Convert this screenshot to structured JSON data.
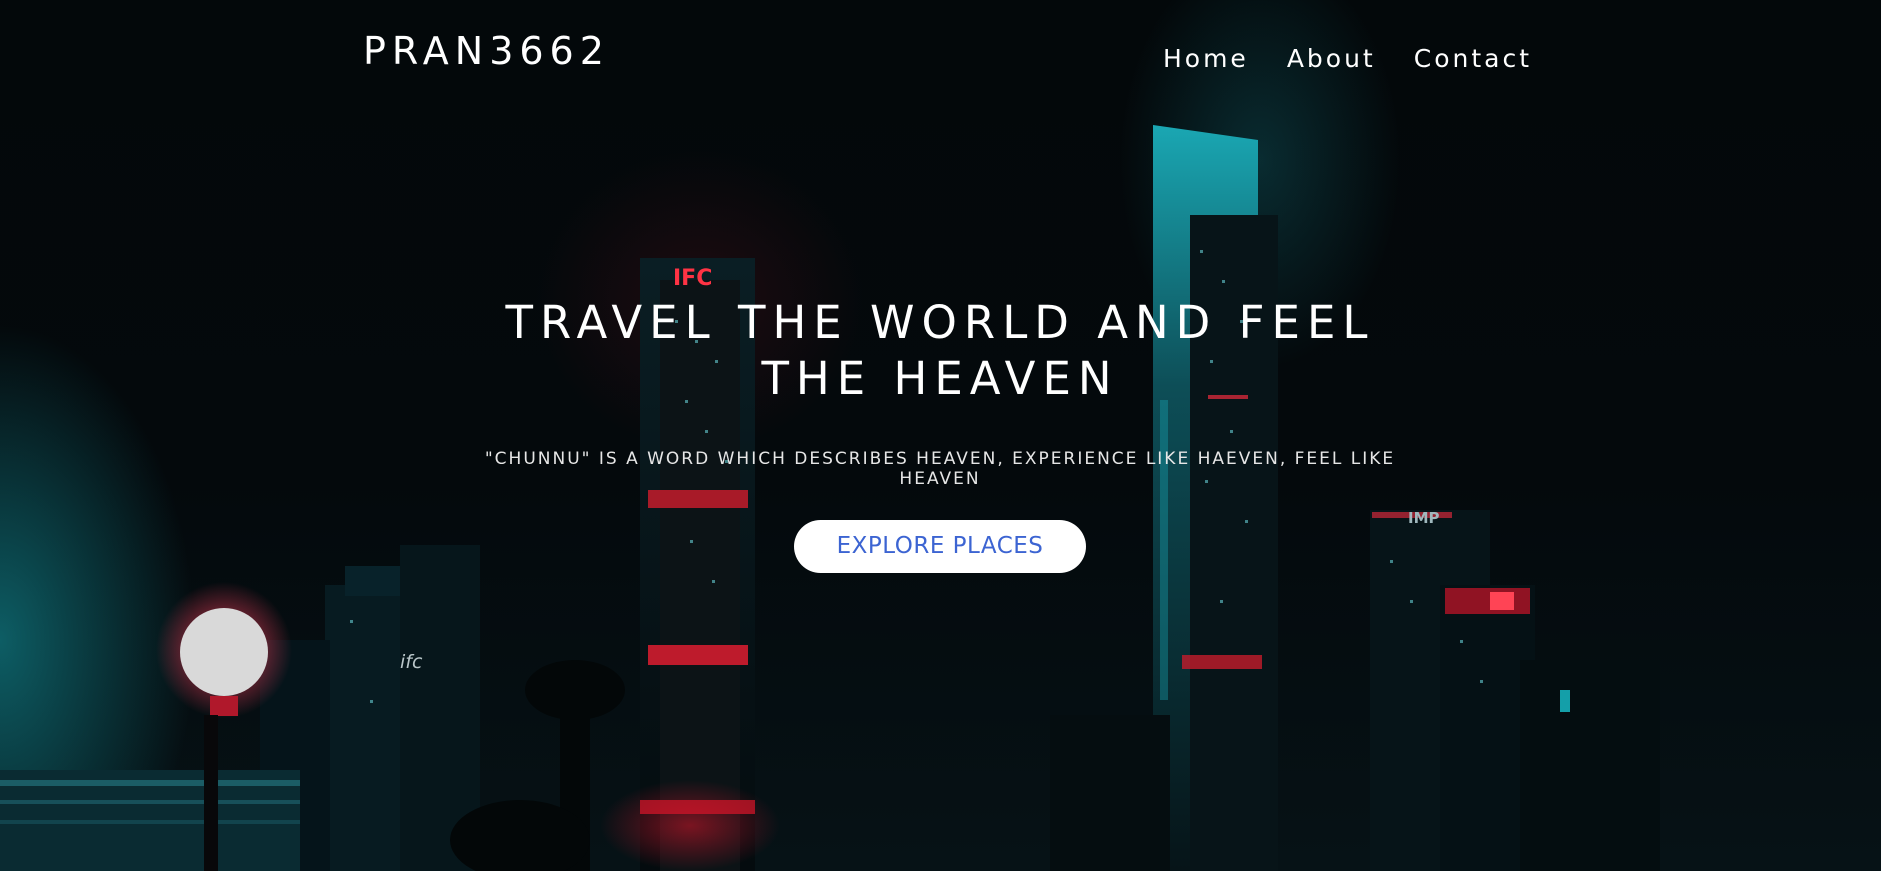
{
  "header": {
    "brand": "PRAN3662",
    "nav": [
      {
        "label": "Home"
      },
      {
        "label": "About"
      },
      {
        "label": "Contact"
      }
    ]
  },
  "hero": {
    "title": "TRAVEL THE WORLD AND FEEL THE HEAVEN",
    "subtitle": "\"CHUNNU\" IS A WORD WHICH DESCRIBES HEAVEN, EXPERIENCE LIKE HAEVEN, FEEL LIKE HEAVEN",
    "cta_label": "EXPLORE PLACES",
    "background": "night city skyline",
    "building_signs": {
      "ifc_top": "IFC",
      "ifc_low": "ifc",
      "imp": "IMP"
    }
  },
  "colors": {
    "accent_cyan": "#19c4cf",
    "accent_red": "#e0202f",
    "cta_text": "#3c64d2",
    "text": "#ffffff"
  }
}
